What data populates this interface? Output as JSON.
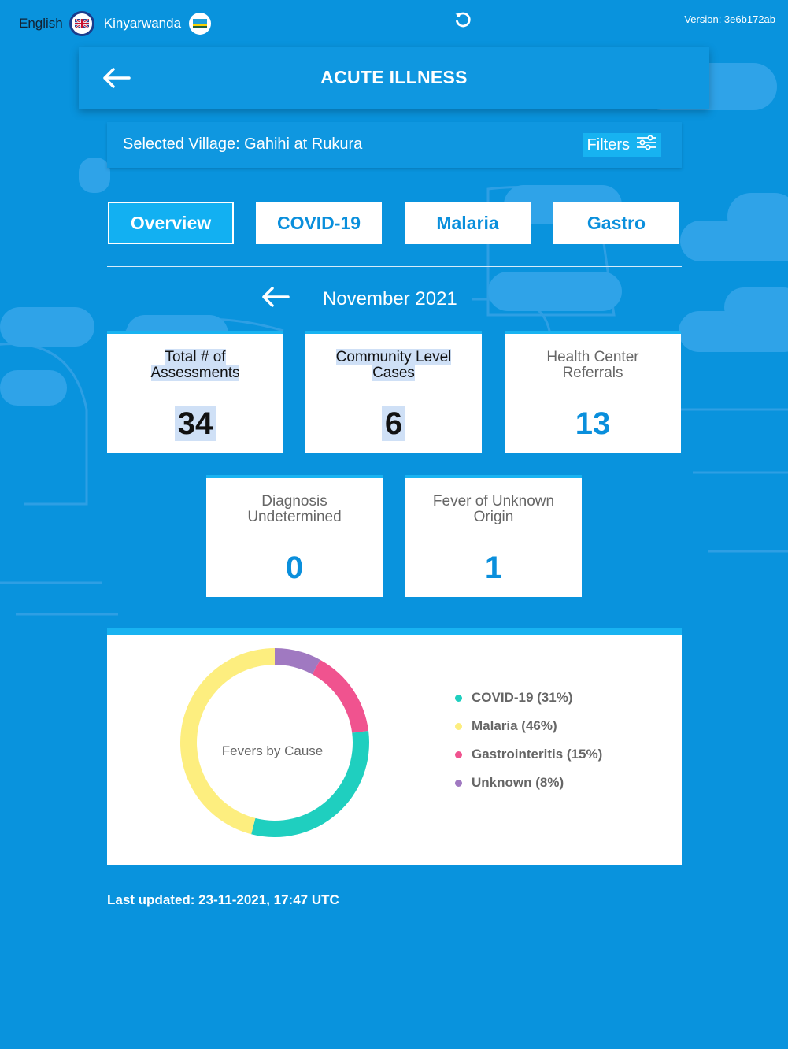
{
  "topbar": {
    "lang_english": "English",
    "lang_kinyarwanda": "Kinyarwanda",
    "version": "Version: 3e6b172ab"
  },
  "header": {
    "title": "ACUTE ILLNESS"
  },
  "village": {
    "label": "Selected Village: Gahihi at Rukura",
    "filters": "Filters"
  },
  "tabs": [
    {
      "label": "Overview",
      "active": true
    },
    {
      "label": "COVID-19",
      "active": false
    },
    {
      "label": "Malaria",
      "active": false
    },
    {
      "label": "Gastro",
      "active": false
    }
  ],
  "month": "November 2021",
  "stats": [
    {
      "label1": "Total # of",
      "label2": "Assessments",
      "value": "34"
    },
    {
      "label1": "Community Level",
      "label2": "Cases",
      "value": "6"
    },
    {
      "label1": "Health Center",
      "label2": "Referrals",
      "value": "13"
    },
    {
      "label1": "Diagnosis",
      "label2": "Undetermined",
      "value": "0"
    },
    {
      "label1": "Fever of Unknown",
      "label2": "Origin",
      "value": "1"
    }
  ],
  "chart": {
    "center_label": "Fevers by Cause",
    "legend": [
      "COVID-19 (31%)",
      "Malaria (46%)",
      "Gastrointeritis (15%)",
      "Unknown (8%)"
    ]
  },
  "chart_data": {
    "type": "pie",
    "title": "Fevers by Cause",
    "categories": [
      "COVID-19",
      "Malaria",
      "Gastrointeritis",
      "Unknown"
    ],
    "values": [
      31,
      46,
      15,
      8
    ],
    "colors": [
      "#1fcfbf",
      "#fdee7f",
      "#f0538f",
      "#a079c1"
    ],
    "legend_position": "right"
  },
  "footer": {
    "updated": "Last updated: 23-11-2021, 17:47 UTC"
  },
  "colors": {
    "background": "#0993dd",
    "accent": "#19b3f1",
    "value_blue": "#0a8fdc"
  }
}
